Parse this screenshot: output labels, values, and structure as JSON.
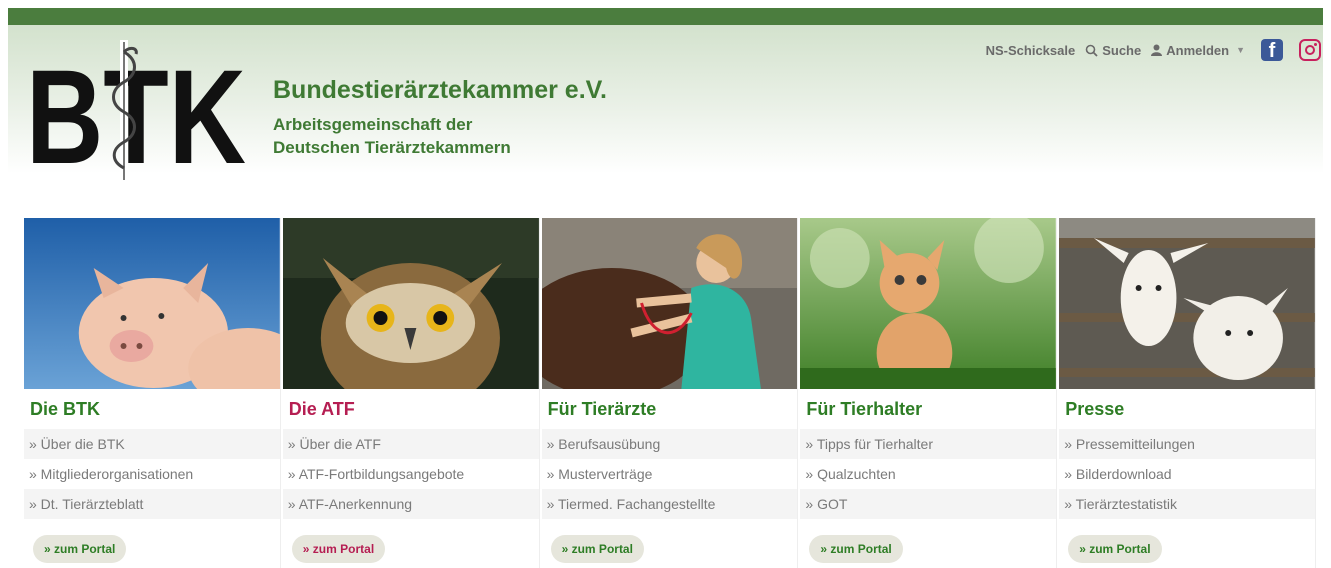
{
  "colors": {
    "brand_green": "#4b7d3e",
    "atf_red": "#b51e52",
    "facebook": "#3b5998",
    "instagram": "#c8205d"
  },
  "logo": {
    "text": "BTK"
  },
  "header": {
    "title": "Bundestierärztekammer e.V.",
    "subtitle_line1": "Arbeitsgemeinschaft der",
    "subtitle_line2": "Deutschen Tierärztekammern"
  },
  "topnav": {
    "ns": "NS-Schicksale",
    "search": "Suche",
    "login": "Anmelden",
    "search_icon": "search-icon",
    "user_icon": "user-icon",
    "facebook_icon": "facebook-icon",
    "instagram_icon": "instagram-icon"
  },
  "cards": [
    {
      "title": "Die BTK",
      "image": "pig-photo",
      "links": [
        "» Über die BTK",
        "» Mitgliederorganisationen",
        "» Dt. Tierärzteblatt"
      ],
      "portal": "» zum Portal"
    },
    {
      "title": "Die ATF",
      "image": "owl-photo",
      "links": [
        "» Über die ATF",
        "» ATF-Fortbildungsangebote",
        "» ATF-Anerkennung"
      ],
      "portal": "» zum Portal"
    },
    {
      "title": "Für Tierärzte",
      "image": "vet-with-horse-photo",
      "links": [
        "» Berufsausübung",
        "» Musterverträge",
        "» Tiermed. Fachangestellte"
      ],
      "portal": "» zum Portal"
    },
    {
      "title": "Für Tierhalter",
      "image": "kitten-photo",
      "links": [
        "» Tipps für Tierhalter",
        "» Qualzuchten",
        "» GOT"
      ],
      "portal": "» zum Portal"
    },
    {
      "title": "Presse",
      "image": "goats-photo",
      "links": [
        "» Pressemitteilungen",
        "» Bilderdownload",
        "» Tierärztestatistik"
      ],
      "portal": "» zum Portal"
    }
  ]
}
